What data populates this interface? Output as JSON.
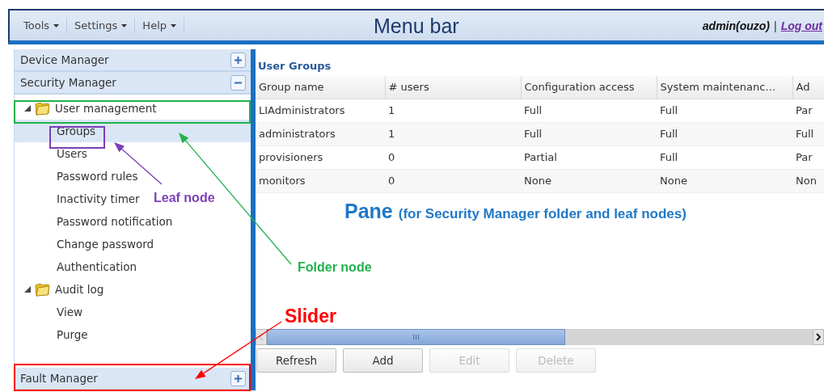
{
  "menu_bar": {
    "menus": [
      {
        "label": "Tools"
      },
      {
        "label": "Settings"
      },
      {
        "label": "Help"
      }
    ],
    "title": "Menu bar",
    "user": "admin(ouzo)",
    "separator": "|",
    "logout": "Log out"
  },
  "sidebar": {
    "sections": [
      {
        "label": "Device Manager",
        "expanded": false
      },
      {
        "label": "Security Manager",
        "expanded": true,
        "tree": [
          {
            "label": "User management",
            "expanded": true,
            "children": [
              {
                "label": "Groups",
                "selected": true
              },
              {
                "label": "Users",
                "selected": false
              },
              {
                "label": "Password rules",
                "selected": false
              },
              {
                "label": "Inactivity timer",
                "selected": false
              },
              {
                "label": "Password notification",
                "selected": false
              },
              {
                "label": "Change password",
                "selected": false
              },
              {
                "label": "Authentication",
                "selected": false
              }
            ]
          },
          {
            "label": "Audit log",
            "expanded": true,
            "children": [
              {
                "label": "View",
                "selected": false
              },
              {
                "label": "Purge",
                "selected": false
              }
            ]
          }
        ]
      },
      {
        "label": "Fault Manager",
        "expanded": false
      }
    ]
  },
  "pane": {
    "title": "User Groups",
    "table": {
      "columns": [
        "Group name",
        "# users",
        "Configuration access",
        "System maintenanc…",
        "Ad"
      ],
      "rows": [
        [
          "LIAdministrators",
          "1",
          "Full",
          "Full",
          "Par"
        ],
        [
          "administrators",
          "1",
          "Full",
          "Full",
          "Full"
        ],
        [
          "provisioners",
          "0",
          "Partial",
          "Full",
          "Par"
        ],
        [
          "monitors",
          "0",
          "None",
          "None",
          "Non"
        ]
      ]
    },
    "caption_title": "Pane",
    "caption": "(for Security Manager folder and leaf nodes)",
    "buttons": [
      {
        "label": "Refresh",
        "disabled": false
      },
      {
        "label": "Add",
        "disabled": false
      },
      {
        "label": "Edit",
        "disabled": true
      },
      {
        "label": "Delete",
        "disabled": true
      }
    ]
  },
  "annotations": [
    {
      "text": "Leaf node",
      "color": "#7b3fb5"
    },
    {
      "text": "Folder node",
      "color": "#22b14c"
    },
    {
      "text": "Slider",
      "color": "#ff0000"
    }
  ]
}
